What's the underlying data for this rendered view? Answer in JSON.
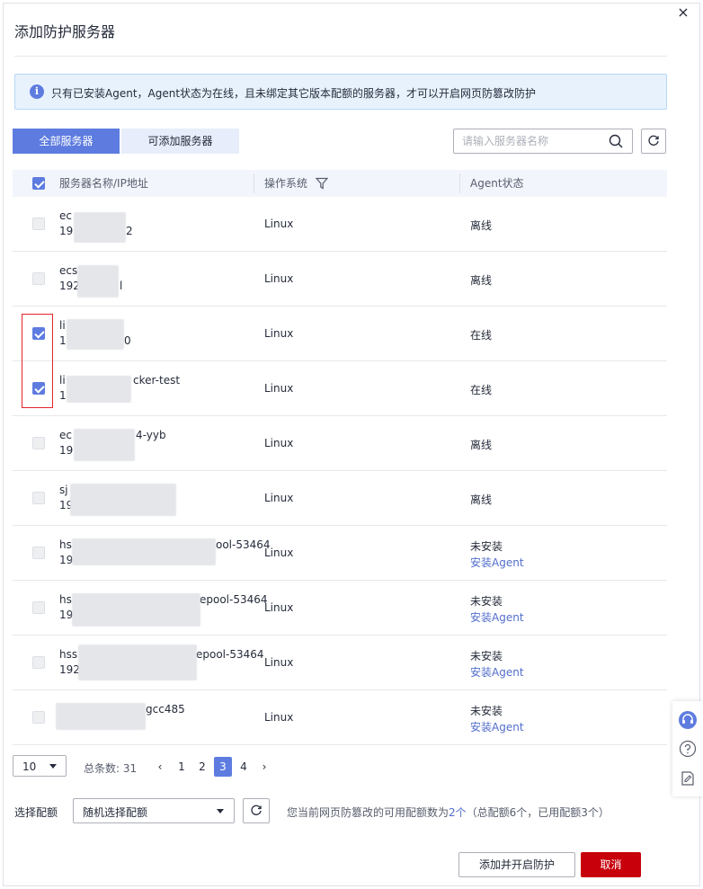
{
  "dialog": {
    "title": "添加防护服务器",
    "close_glyph": "×"
  },
  "notice": {
    "icon": "info-icon",
    "text": "只有已安装Agent，Agent状态为在线，且未绑定其它版本配额的服务器，才可以开启网页防篡改防护"
  },
  "tabs": {
    "all": "全部服务器",
    "addable": "可添加服务器"
  },
  "search": {
    "placeholder": "请输入服务器名称"
  },
  "table": {
    "columns": {
      "name": "服务器名称/IP地址",
      "os": "操作系统",
      "agent": "Agent状态"
    },
    "rows": [
      {
        "name": "ec",
        "ip": "19",
        "ip_tail": "2",
        "os": "Linux",
        "agent": "离线",
        "checked": false
      },
      {
        "name": "ecs",
        "ip": "192",
        "ip_tail": "l",
        "os": "Linux",
        "agent": "离线",
        "checked": false
      },
      {
        "name": "li",
        "ip": "1",
        "ip_tail": "0",
        "os": "Linux",
        "agent": "在线",
        "checked": true
      },
      {
        "name": "li",
        "name_tail": "cker-test",
        "ip": "1",
        "os": "Linux",
        "agent": "在线",
        "checked": true
      },
      {
        "name": "ec",
        "name_tail": "4-yyb",
        "ip": "19",
        "os": "Linux",
        "agent": "离线",
        "checked": false
      },
      {
        "name": "sj",
        "ip": "19",
        "os": "Linux",
        "agent": "离线",
        "checked": false
      },
      {
        "name": "hs",
        "name_tail": "ool-53464",
        "ip": "19",
        "os": "Linux",
        "agent": "未安装",
        "install": "安装Agent",
        "checked": false
      },
      {
        "name": "hs",
        "name_tail": "epool-53464",
        "ip": "19",
        "os": "Linux",
        "agent": "未安装",
        "install": "安装Agent",
        "checked": false
      },
      {
        "name": "hss",
        "name_tail": "epool-53464",
        "ip": "192",
        "os": "Linux",
        "agent": "未安装",
        "install": "安装Agent",
        "checked": false
      },
      {
        "name": "",
        "name_tail": "gcc485",
        "ip": "",
        "os": "Linux",
        "agent": "未安装",
        "install": "安装Agent",
        "checked": false
      }
    ]
  },
  "pagination": {
    "page_size": "10",
    "total_label": "总条数: 31",
    "pages": [
      "1",
      "2",
      "3",
      "4"
    ],
    "current": "3",
    "prev": "‹",
    "next": "›"
  },
  "quota": {
    "label": "选择配额",
    "selected": "随机选择配额",
    "info_prefix": "您当前网页防篡改的可用配额数为",
    "available": "2个",
    "info_suffix": "（总配额6个，已用配额3个）"
  },
  "footer": {
    "confirm": "添加并开启防护",
    "cancel": "取消"
  },
  "side_tools": [
    "headset-icon",
    "help-icon",
    "feedback-icon"
  ],
  "colors": {
    "accent": "#5e7ce0",
    "link": "#526ecc",
    "danger": "#c7000b"
  }
}
